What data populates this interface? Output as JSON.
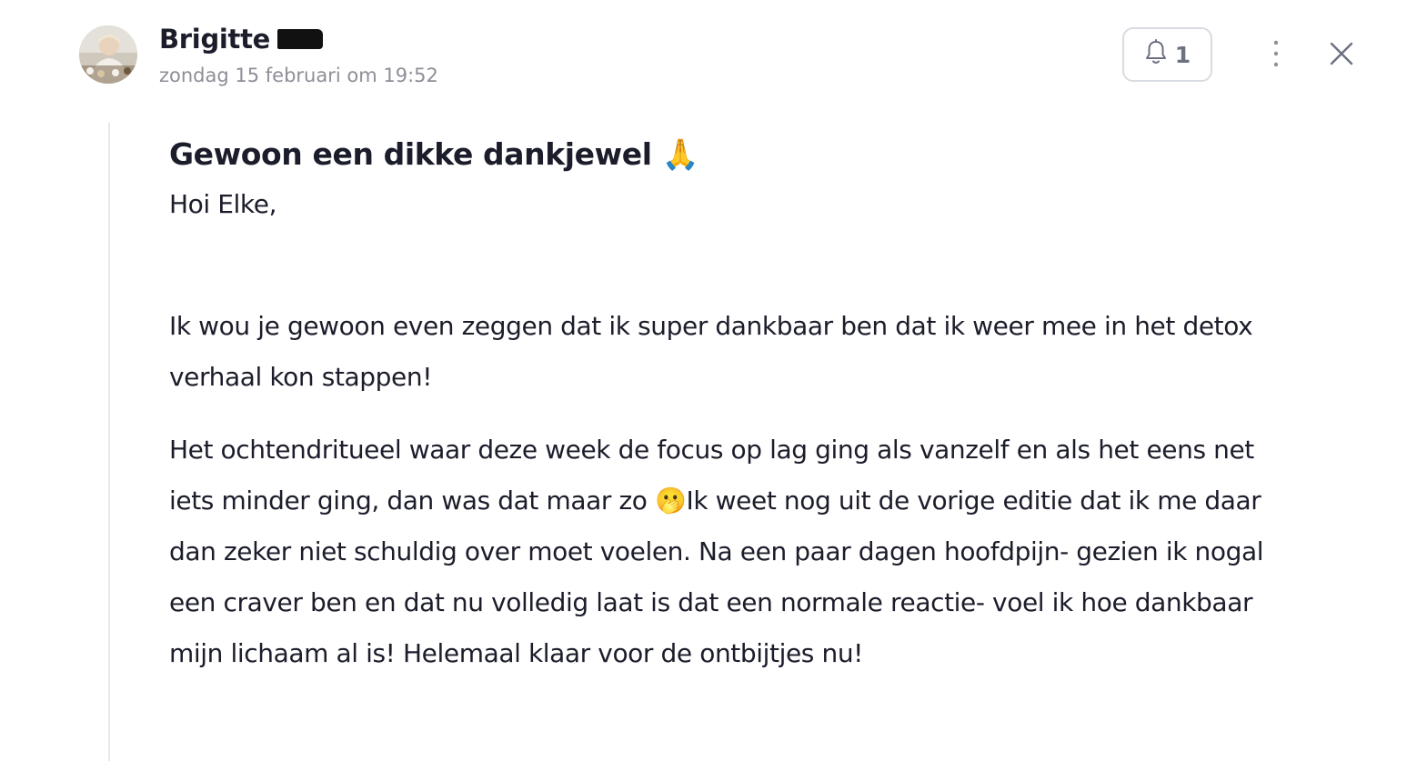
{
  "author": {
    "name": "Brigitte",
    "timestamp": "zondag 15 februari om 19:52"
  },
  "header": {
    "notification_count": "1"
  },
  "post": {
    "title": "Gewoon een dikke dankjewel 🙏",
    "greeting": "Hoi Elke,",
    "paragraphs": [
      "Ik wou je gewoon even zeggen dat ik  super dankbaar ben dat ik weer mee in het detox verhaal kon stappen!",
      "Het ochtendritueel waar deze week de focus op lag ging als vanzelf en als het eens net iets minder ging, dan was dat maar zo 🫢Ik weet nog uit de vorige editie dat ik me daar dan zeker niet schuldig over moet voelen. Na een paar dagen hoofdpijn- gezien ik nogal een craver ben en dat nu volledig laat is dat een normale reactie- voel ik hoe dankbaar mijn lichaam al is! Helemaal klaar voor de ontbijtjes nu!"
    ]
  },
  "icons": {
    "avatar": "avatar-photo",
    "notify": "bell-icon",
    "more": "more-vertical-icon",
    "close": "close-icon"
  },
  "colors": {
    "text": "#1c1d2b",
    "muted": "#8e8f98",
    "border": "#d8dbe1",
    "icon": "#6b7180"
  }
}
